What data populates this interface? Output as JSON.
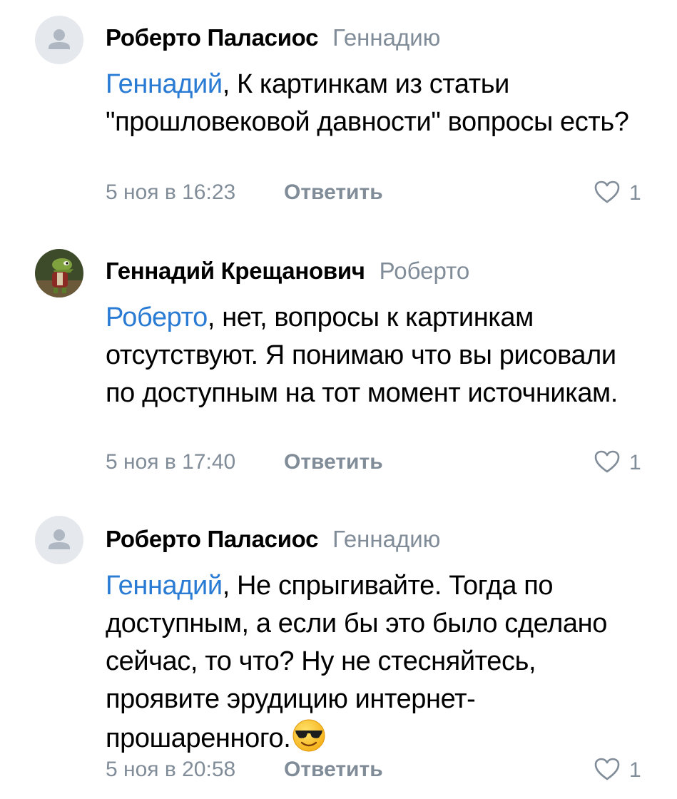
{
  "comments": [
    {
      "author": "Роберто Паласиос",
      "reply_to": "Геннадию",
      "mention": "Геннадий",
      "text": ", К картинкам из статьи \"прошловековой давности\" вопросы есть?",
      "date": "5 ноя в 16:23",
      "reply_label": "Ответить",
      "likes": "1",
      "avatar": "placeholder-avatar-icon"
    },
    {
      "author": "Геннадий Крещанович",
      "reply_to": "Роберто",
      "mention": "Роберто",
      "text": ", нет, вопросы к картинкам отсутствуют. Я понимаю что вы рисовали по доступным  на тот момент источникам.",
      "date": "5 ноя в 17:40",
      "reply_label": "Ответить",
      "likes": "1",
      "avatar": "crocodile-photo-avatar"
    },
    {
      "author": "Роберто Паласиос",
      "reply_to": "Геннадию",
      "mention": "Геннадий",
      "text": ", Не спрыгивайте. Тогда по доступным, а если бы это было сделано сейчас, то что? Ну не стесняйтесь, проявите эрудицию интернет-прошаренного.",
      "emoji": "sunglasses-emoji",
      "date": "5 ноя в 20:58",
      "reply_label": "Ответить",
      "likes": "1",
      "avatar": "placeholder-avatar-icon"
    }
  ],
  "colors": {
    "mention": "#2a7bd3",
    "secondary": "#818c99",
    "avatar_placeholder": "#e5e8ec"
  }
}
